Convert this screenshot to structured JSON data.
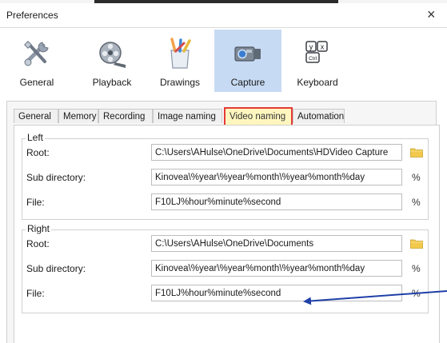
{
  "window": {
    "title": "Preferences",
    "close_glyph": "×"
  },
  "toolbar": {
    "items": [
      {
        "label": "General",
        "icon": "tools-icon"
      },
      {
        "label": "Playback",
        "icon": "film-reel-icon"
      },
      {
        "label": "Drawings",
        "icon": "pencil-cup-icon"
      },
      {
        "label": "Capture",
        "icon": "camera-icon",
        "active": true
      },
      {
        "label": "Keyboard",
        "icon": "keyboard-icon"
      }
    ]
  },
  "tabs": [
    {
      "label": "General"
    },
    {
      "label": "Memory"
    },
    {
      "label": "Recording"
    },
    {
      "label": "Image naming"
    },
    {
      "label": "Video naming",
      "selected": true
    },
    {
      "label": "Automation"
    }
  ],
  "left": {
    "title": "Left",
    "root_label": "Root:",
    "root_value": "C:\\Users\\AHulse\\OneDrive\\Documents\\HDVideo Capture",
    "subdir_label": "Sub directory:",
    "subdir_value": "Kinovea\\%year\\%year%month\\%year%month%day",
    "file_label": "File:",
    "file_value": "F10LJ%hour%minute%second"
  },
  "right": {
    "title": "Right",
    "root_label": "Root:",
    "root_value": "C:\\Users\\AHulse\\OneDrive\\Documents",
    "subdir_label": "Sub directory:",
    "subdir_value": "Kinovea\\%year\\%year%month\\%year%month%day",
    "file_label": "File:",
    "file_value": "F10LJ%hour%minute%second"
  },
  "macro_glyph": "%",
  "colors": {
    "active_tool": "#c7daf3",
    "selected_tab_highlight": "#e53935",
    "annotation_arrow": "#1f3fa8",
    "folder": "#f2c94c"
  }
}
